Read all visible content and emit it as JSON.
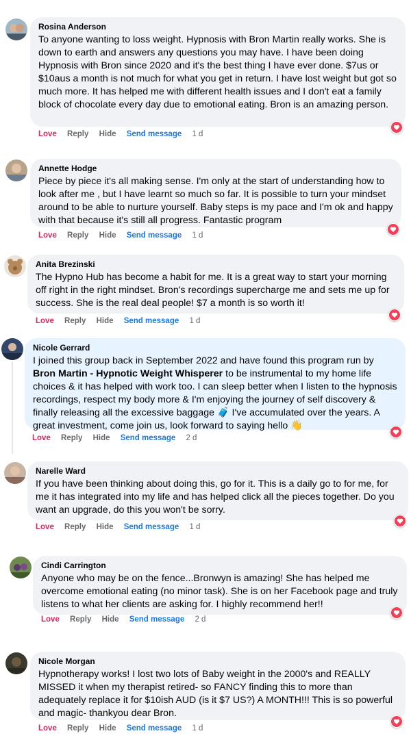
{
  "actions": {
    "love": "Love",
    "reply": "Reply",
    "hide": "Hide",
    "send_message": "Send message"
  },
  "colors": {
    "bubble": "#f0f2f5",
    "bubble_highlight": "#e7f3ff",
    "love": "#e0245e",
    "link": "#1877f2",
    "muted": "#65676b"
  },
  "comments": [
    {
      "author": "Rosina Anderson",
      "text": "To anyone wanting to loss weight. Hypnosis with Bron Martin really works. She is down to earth and answers any questions you may have. I have been doing Hypnosis with Bron since 2020 and it's the best thing I have ever done. $7us or $10aus a month is not much for what you get in return. I have lost weight but got so much more. It has helped me with different health issues and I don't eat a family block of chocolate every day due to emotional eating. Bron is an amazing person.",
      "time": "1 d",
      "reaction": "love-reaction-icon"
    },
    {
      "author": "Annette Hodge",
      "text": "Piece by piece it's all making sense. I'm only at the start of understanding how to look after me , but I have learnt so much so far. It is possible to turn your mindset around to be able to nurture yourself. Baby steps is my pace and I'm ok and happy with that because it's still all progress. Fantastic program",
      "time": "1 d",
      "reaction": "love-reaction-icon"
    },
    {
      "author": "Anita Brezinski",
      "text": "The Hypno Hub has become a habit for me. It is a great way to start your morning off right in the right mindset. Bron's recordings supercharge me and sets me up for success. She is the real deal people! $7 a month is so worth it!",
      "time": "1 d",
      "reaction": "love-reaction-icon"
    },
    {
      "author": "Nicole Gerrard",
      "text_before": "I joined this group back in September 2022 and have found this program run by ",
      "text_bold": "Bron Martin - Hypnotic Weight Whisperer",
      "text_after": " to be instrumental to my home life choices & it has helped with work too. I can sleep better when I listen to the hypnosis recordings, respect my body more & I'm enjoying the journey of self discovery & finally releasing all the excessive baggage 🧳 I've accumulated over the years. A great investment, come join us, look forward to saying hello 👋",
      "time": "2 d",
      "reaction": "love-reaction-icon"
    },
    {
      "author": "Narelle Ward",
      "text": "If you have been thinking about doing this, go for it. This is a daily go to for me, for me it has integrated into my life and has helped click all the pieces together. Do you want an upgrade, do this you won't be sorry.",
      "time": "1 d",
      "reaction": "love-reaction-icon"
    },
    {
      "author": "Cindi Carrington",
      "text": "Anyone who may be on the fence...Bronwyn is amazing! She has helped me overcome emotional eating (no minor task). She is on her Facebook page and truly listens to what her clients are asking for. I highly recommend her!!",
      "time": "2 d",
      "reaction": "love-reaction-icon"
    },
    {
      "author": "Nicole Morgan",
      "text": "Hypnotherapy works! I lost two lots of Baby weight in the 2000's and REALLY MISSED it when my therapist retired- so FANCY finding this to more than adequately replace it for $10ish AUD (is it $7 US?) A MONTH!!! This is so powerful and magic- thankyou dear Bron.",
      "time": "1 d",
      "reaction": "love-reaction-icon"
    }
  ]
}
